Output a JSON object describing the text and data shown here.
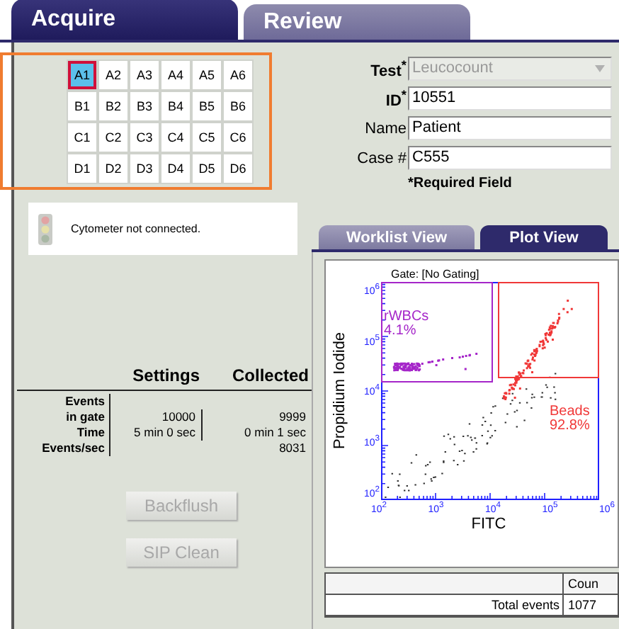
{
  "tabs": [
    {
      "label": "Acquire",
      "selected": true
    },
    {
      "label": "Review",
      "selected": false
    }
  ],
  "wells": [
    [
      {
        "label": "A1",
        "selected": true
      },
      {
        "label": "A2",
        "selected": false
      },
      {
        "label": "A3",
        "selected": false
      },
      {
        "label": "A4",
        "selected": false
      },
      {
        "label": "A5",
        "selected": false
      },
      {
        "label": "A6",
        "selected": false
      }
    ],
    [
      {
        "label": "B1",
        "selected": false
      },
      {
        "label": "B2",
        "selected": false
      },
      {
        "label": "B3",
        "selected": false
      },
      {
        "label": "B4",
        "selected": false
      },
      {
        "label": "B5",
        "selected": false
      },
      {
        "label": "B6",
        "selected": false
      }
    ],
    [
      {
        "label": "C1",
        "selected": false
      },
      {
        "label": "C2",
        "selected": false
      },
      {
        "label": "C3",
        "selected": false
      },
      {
        "label": "C4",
        "selected": false
      },
      {
        "label": "C5",
        "selected": false
      },
      {
        "label": "C6",
        "selected": false
      }
    ],
    [
      {
        "label": "D1",
        "selected": false
      },
      {
        "label": "D2",
        "selected": false
      },
      {
        "label": "D3",
        "selected": false
      },
      {
        "label": "D4",
        "selected": false
      },
      {
        "label": "D5",
        "selected": false
      },
      {
        "label": "D6",
        "selected": false
      }
    ]
  ],
  "status": {
    "message": "Cytometer not connected."
  },
  "form": {
    "fields": [
      {
        "label": "Test$^{*}$",
        "required": true,
        "kind": "dropdown",
        "value": "Leucocount",
        "disabled": true
      },
      {
        "label": "ID$^{*}$",
        "required": true,
        "kind": "text",
        "value": "10551",
        "disabled": false
      },
      {
        "label": "Name",
        "required": false,
        "kind": "text",
        "value": "Patient",
        "disabled": false
      },
      {
        "label": "Case #",
        "required": false,
        "kind": "text",
        "value": "C555",
        "disabled": false
      }
    ],
    "note": "*Required Field"
  },
  "stats": {
    "columns": [
      "Settings",
      "Collected"
    ],
    "rows": [
      {
        "label": "Events\nin gate",
        "settings": "10000",
        "collected": "9999"
      },
      {
        "label": "Time",
        "settings": "5 min 0 sec",
        "collected": "0 min 1 sec"
      },
      {
        "label": "Events/sec",
        "collected": "8031"
      }
    ]
  },
  "buttons": [
    {
      "label": "Backflush",
      "disabled": true
    },
    {
      "label": "SIP Clean",
      "disabled": true
    }
  ],
  "view_tabs": [
    {
      "label": "Worklist View",
      "selected": false
    },
    {
      "label": "Plot View",
      "selected": true
    }
  ],
  "plot": {
    "title": "Gate:  [No Gating]",
    "xlabel": "FITC",
    "ylabel": "Propidium Iodide",
    "xticks": [
      "10$^{2}$",
      "10$^{3}$",
      "10$^{4}$",
      "10$^{5}$",
      "10$^{6}$"
    ],
    "yticks": [
      "10$^{6}$",
      "10$^{5}$",
      "10$^{4}$",
      "10$^{3}$",
      "10$^{2}$"
    ],
    "gates": [
      {
        "kind": "upper-left",
        "name": "rWBCs",
        "percent": "4.1%",
        "color": "#a526c9"
      },
      {
        "kind": "upper-right",
        "name": "Beads",
        "percent": "92.8%",
        "color": "#f03838"
      }
    ]
  },
  "results": {
    "header": "Coun",
    "rows": [
      {
        "label": "Total events",
        "count": "1077"
      }
    ]
  }
}
